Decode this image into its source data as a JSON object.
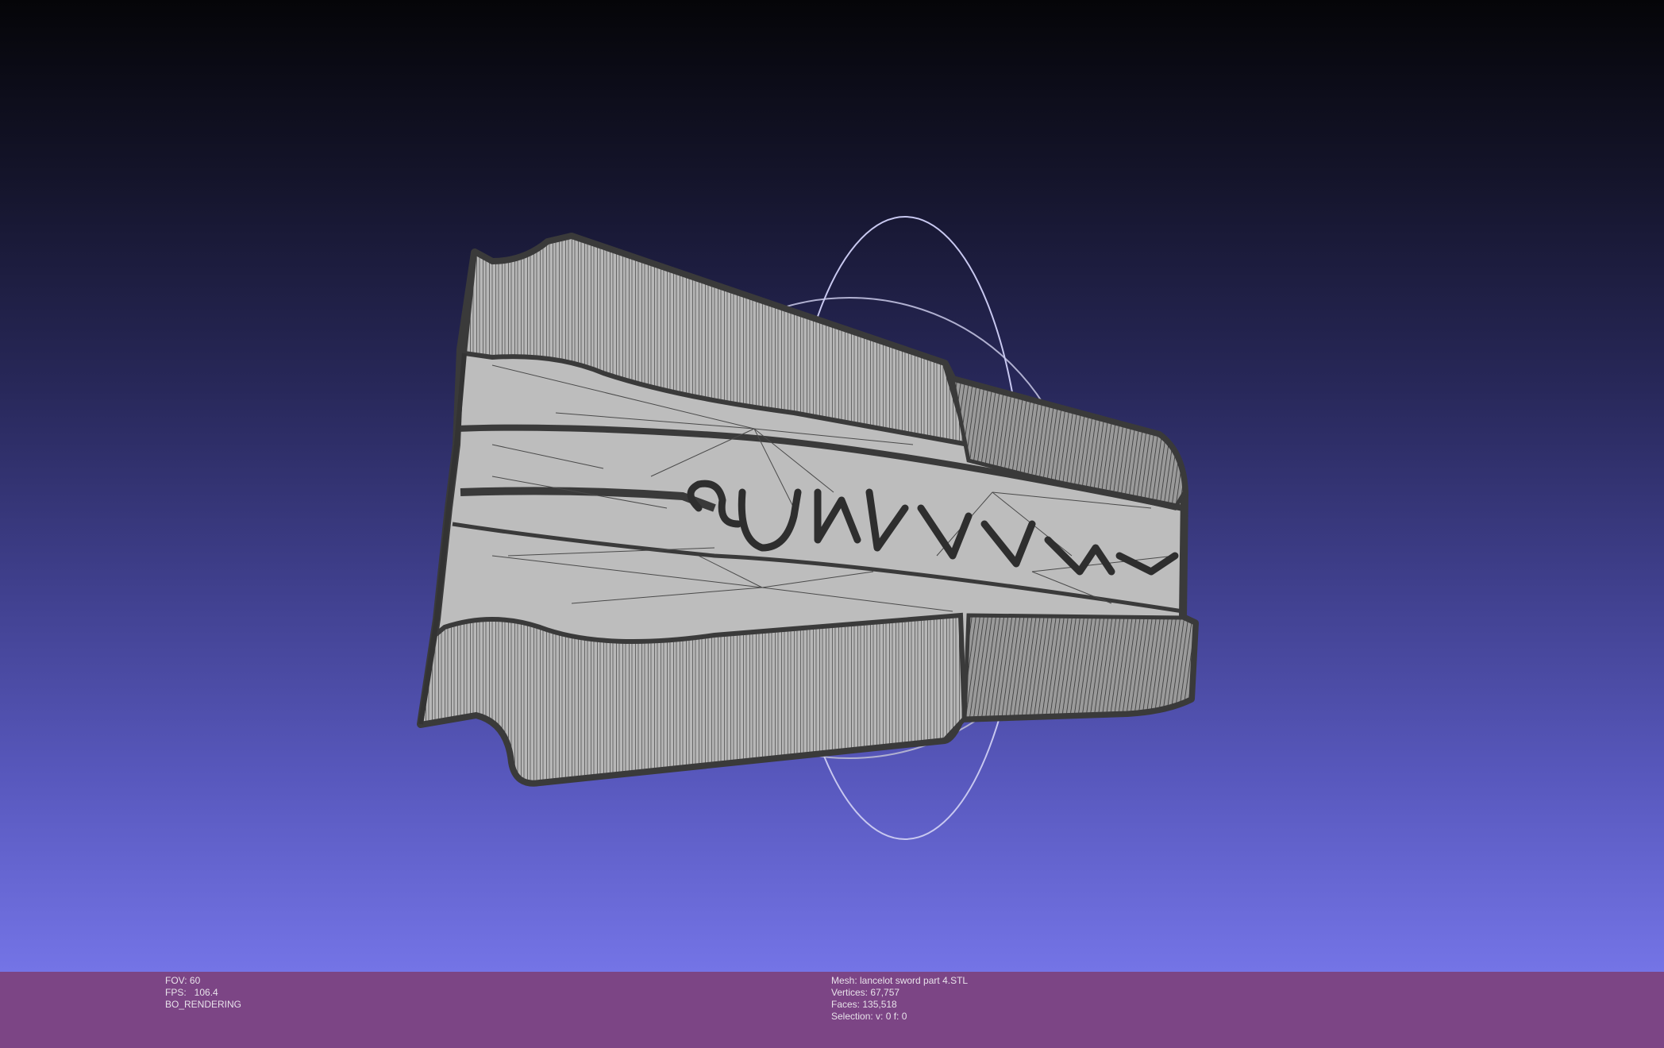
{
  "info_bar": {
    "left": {
      "fov": "FOV: 60",
      "fps": "FPS:   106.4",
      "mode": "BO_RENDERING"
    },
    "right": {
      "mesh": "Mesh: lancelot sword part 4.STL",
      "vertices": "Vertices: 67,757",
      "faces": "Faces: 135,518",
      "selection": "Selection: v: 0 f: 0"
    }
  },
  "scene": {
    "background_top": "#050508",
    "background_bottom": "#7474e6",
    "mesh_fill": "#bdbdbd",
    "mesh_wire": "#3a3a3a",
    "trackball_color": "#b8b8d8"
  }
}
